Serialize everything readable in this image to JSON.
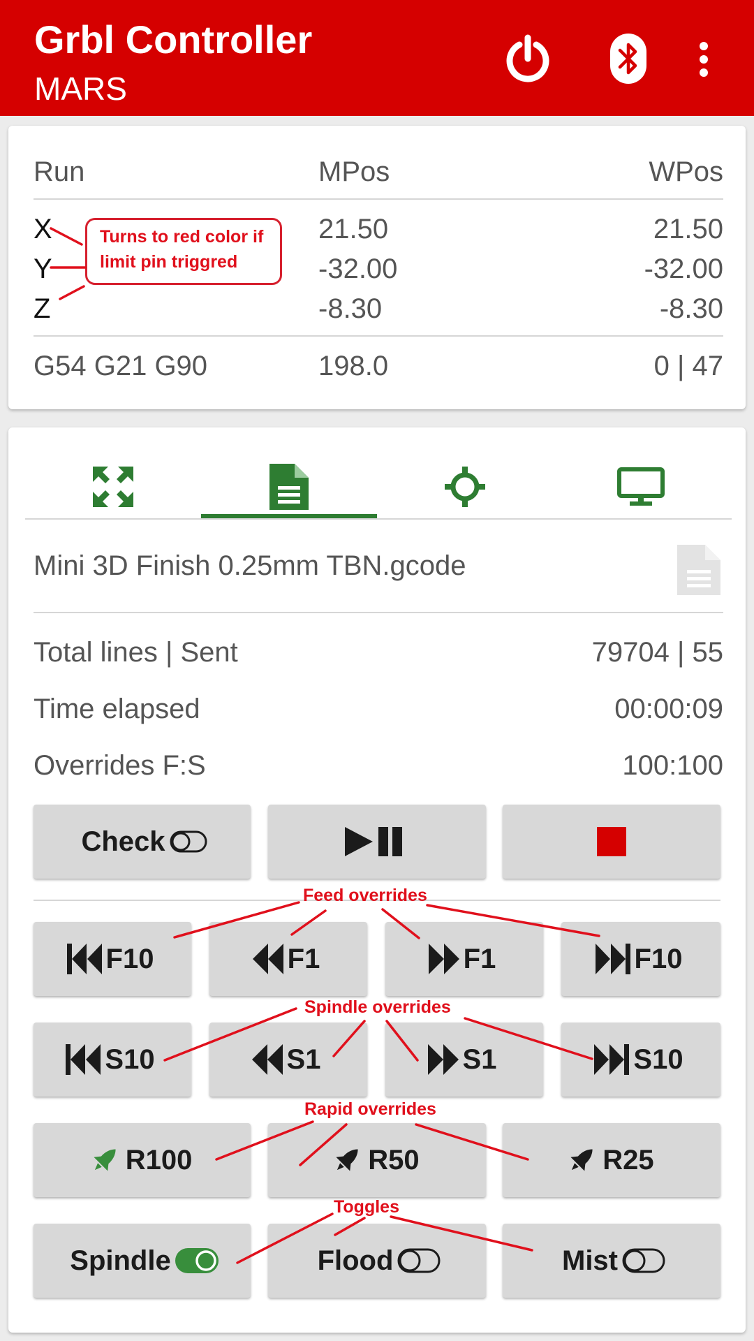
{
  "app_bar": {
    "title": "Grbl Controller",
    "subtitle": "MARS",
    "icons": [
      "power-icon",
      "bluetooth-icon",
      "more-vert-icon"
    ],
    "color": "#d50000"
  },
  "status_card": {
    "state": "Run",
    "mpos_header": "MPos",
    "wpos_header": "WPos",
    "axes": [
      {
        "label": "X",
        "mpos": "21.50",
        "wpos": "21.50"
      },
      {
        "label": "Y",
        "mpos": "-32.00",
        "wpos": "-32.00"
      },
      {
        "label": "Z",
        "mpos": "-8.30",
        "wpos": "-8.30"
      }
    ],
    "modes": "G54 G21 G90",
    "feed": "198.0",
    "buffer": "0 | 47",
    "callout": [
      "Turns to red color if",
      "limit pin triggred"
    ]
  },
  "tabs": [
    {
      "name": "jog",
      "icon": "move-arrows-icon"
    },
    {
      "name": "file",
      "icon": "file-icon",
      "active": true
    },
    {
      "name": "probe",
      "icon": "crosshair-icon"
    },
    {
      "name": "console",
      "icon": "monitor-icon"
    }
  ],
  "file": {
    "name": "Mini 3D Finish 0.25mm TBN.gcode",
    "icon": "document-icon"
  },
  "job_info": {
    "rows": [
      {
        "label": "Total lines | Sent",
        "value": "79704 | 55"
      },
      {
        "label": "Time elapsed",
        "value": "00:00:09"
      },
      {
        "label": "Overrides F:S",
        "value": "100:100"
      }
    ]
  },
  "controls": {
    "check_label": "Check",
    "check_on": false,
    "play_pause": "play-pause-icon",
    "stop": "stop-icon"
  },
  "feed_overrides": {
    "annotation": "Feed overrides",
    "buttons": [
      "F10",
      "F1",
      "F1",
      "F10"
    ]
  },
  "spindle_overrides": {
    "annotation": "Spindle overrides",
    "buttons": [
      "S10",
      "S1",
      "S1",
      "S10"
    ]
  },
  "rapid_overrides": {
    "annotation": "Rapid overrides",
    "buttons": [
      "R100",
      "R50",
      "R25"
    ],
    "active": "R100"
  },
  "toggles": {
    "annotation": "Toggles",
    "buttons": [
      {
        "label": "Spindle",
        "on": true
      },
      {
        "label": "Flood",
        "on": false
      },
      {
        "label": "Mist",
        "on": false
      }
    ]
  },
  "colors": {
    "accent_green": "#2e7d32",
    "toggle_green": "#388e3c",
    "stop_red": "#d50000",
    "annotation_red": "#e0101c"
  }
}
